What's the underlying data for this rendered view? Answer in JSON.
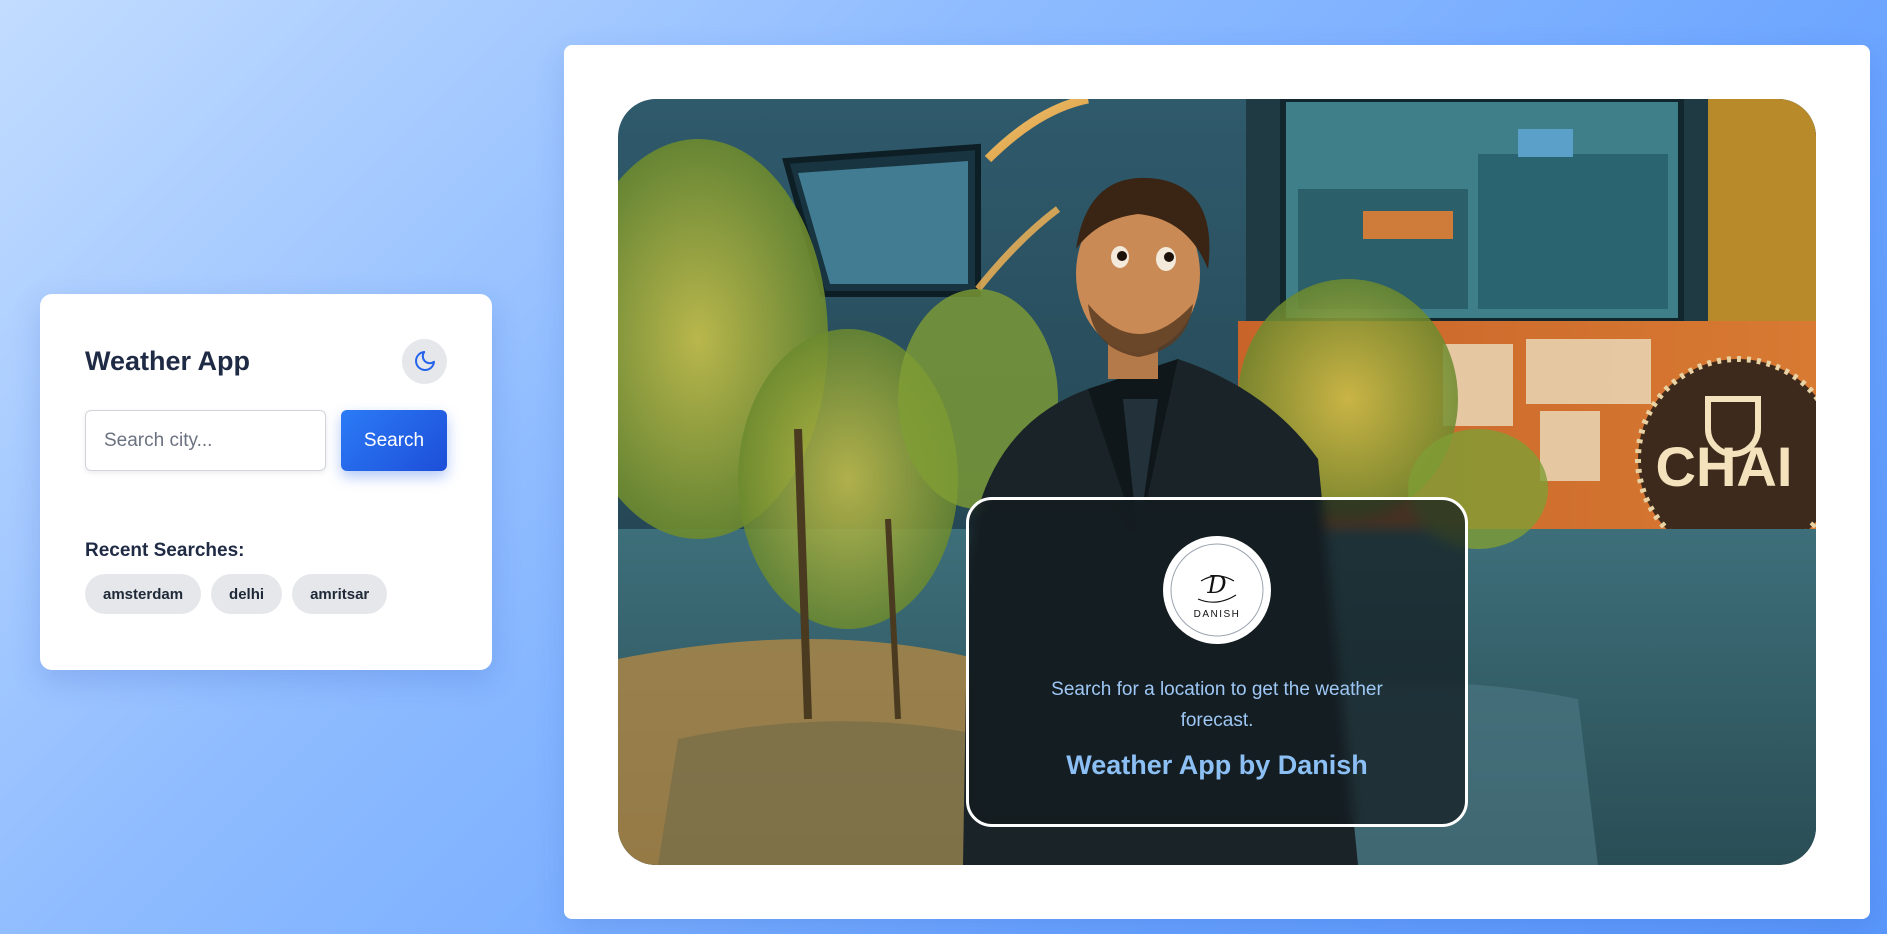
{
  "sidebar": {
    "title": "Weather App",
    "theme_toggle_icon": "moon-icon",
    "search": {
      "placeholder": "Search city...",
      "value": "",
      "button_label": "Search"
    },
    "recent": {
      "title": "Recent Searches:",
      "items": [
        "amsterdam",
        "delhi",
        "amritsar"
      ]
    }
  },
  "main": {
    "hero_image": "illustrated man in dark suit at night outside a chai shop",
    "hero_sign_text": "CHAI",
    "overlay": {
      "logo_text": "DANISH",
      "message": "Search for a location to get the weather forecast.",
      "credit": "Weather App by Danish"
    }
  },
  "colors": {
    "accent": "#2563eb",
    "title_text": "#1f2a44",
    "overlay_text": "#9ec7f5"
  }
}
